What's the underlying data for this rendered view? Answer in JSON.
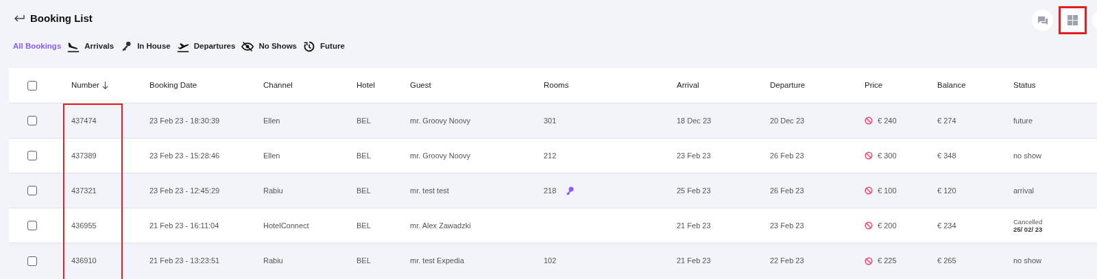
{
  "header": {
    "title": "Booking List"
  },
  "toolbar": [
    {
      "kind": "chat",
      "highlighted": false
    },
    {
      "kind": "grid",
      "highlighted": true
    },
    {
      "kind": "blank",
      "highlighted": false
    }
  ],
  "filters": [
    {
      "label": "All Bookings",
      "kind": "all",
      "selected": true
    },
    {
      "label": "Arrivals",
      "kind": "arrivals",
      "selected": false
    },
    {
      "label": "In House",
      "kind": "in_house",
      "selected": false
    },
    {
      "label": "Departures",
      "kind": "departures",
      "selected": false
    },
    {
      "label": "No Shows",
      "kind": "no_shows",
      "selected": false
    },
    {
      "label": "Future",
      "kind": "future",
      "selected": false
    }
  ],
  "table": {
    "select_all": {
      "checked": false
    },
    "columns": [
      {
        "label": "Number",
        "sorted": true,
        "highlighted": true
      },
      {
        "label": "Booking Date"
      },
      {
        "label": "Channel"
      },
      {
        "label": "Hotel"
      },
      {
        "label": "Guest"
      },
      {
        "label": "Rooms"
      },
      {
        "label": "Arrival"
      },
      {
        "label": "Departure"
      },
      {
        "label": "Price"
      },
      {
        "label": "Balance"
      },
      {
        "label": "Status"
      }
    ],
    "rows": [
      {
        "checked": false,
        "number": "437474",
        "booking_date": "23 Feb 23 - 18:30:39",
        "channel": "Ellen",
        "hotel": "BEL",
        "guest": "mr. Groovy Noovy",
        "rooms": "301",
        "key": false,
        "arrival": "18 Dec 23",
        "departure": "20 Dec 23",
        "price_warning": true,
        "price": "€ 240",
        "balance": "€ 274",
        "status": "future"
      },
      {
        "checked": false,
        "number": "437389",
        "booking_date": "23 Feb 23 - 15:28:46",
        "channel": "Ellen",
        "hotel": "BEL",
        "guest": "mr. Groovy Noovy",
        "rooms": "212",
        "key": false,
        "arrival": "23 Feb 23",
        "departure": "26 Feb 23",
        "price_warning": true,
        "price": "€ 300",
        "balance": "€ 348",
        "status": "no show"
      },
      {
        "checked": false,
        "number": "437321",
        "booking_date": "23 Feb 23 - 12:45:29",
        "channel": "Rabiu",
        "hotel": "BEL",
        "guest": "mr. test test",
        "rooms": "218",
        "key": true,
        "arrival": "25 Feb 23",
        "departure": "26 Feb 23",
        "price_warning": true,
        "price": "€ 100",
        "balance": "€ 120",
        "status": "arrival"
      },
      {
        "checked": false,
        "number": "436955",
        "booking_date": "21 Feb 23 - 16:11:04",
        "channel": "HotelConnect",
        "hotel": "BEL",
        "guest": "mr. Alex Zawadzki",
        "key": false,
        "arrival": "21 Feb 23",
        "departure": "23 Feb 23",
        "price_warning": true,
        "price": "€ 200",
        "balance": "€ 234",
        "status": "Cancelled",
        "status_date": "25/ 02/ 23"
      },
      {
        "checked": false,
        "number": "436910",
        "booking_date": "21 Feb 23 - 13:23:51",
        "channel": "Rabiu",
        "hotel": "BEL",
        "guest": "mr. test Expedia",
        "rooms": "102",
        "key": false,
        "arrival": "21 Feb 23",
        "departure": "22 Feb 23",
        "price_warning": true,
        "price": "€ 225",
        "balance": "€ 265",
        "status": "no show"
      }
    ]
  }
}
